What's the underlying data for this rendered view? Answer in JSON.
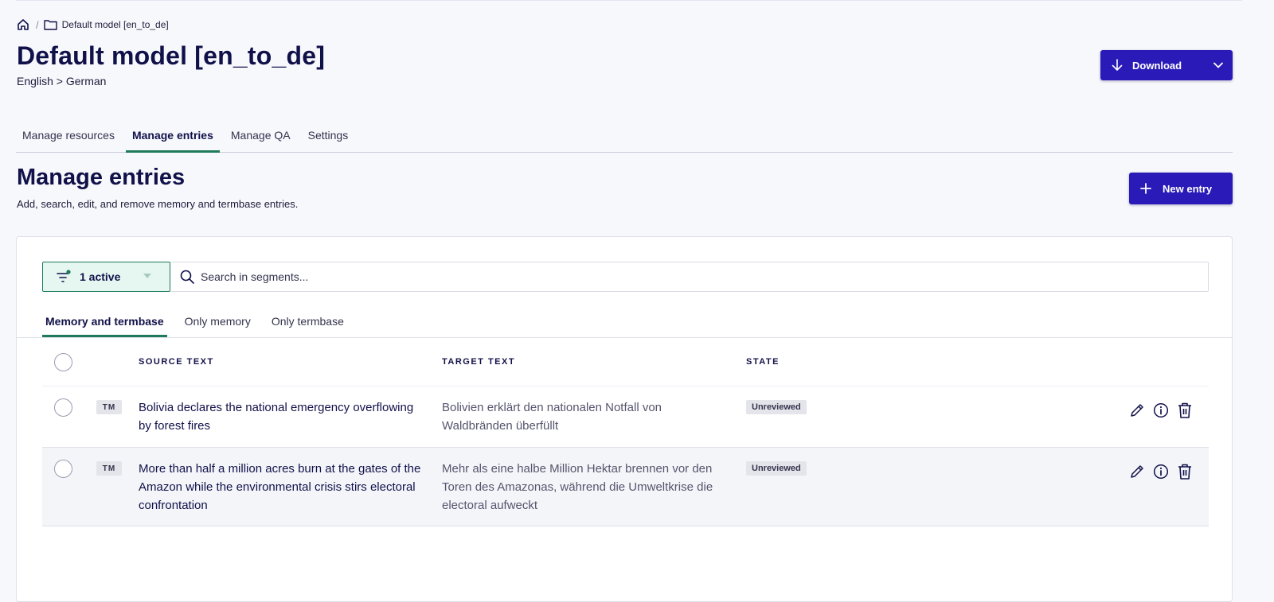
{
  "breadcrumb": {
    "current": "Default model [en_to_de]"
  },
  "header": {
    "title": "Default model [en_to_de]",
    "language_pair": "English > German",
    "download_label": "Download"
  },
  "tabs": [
    {
      "label": "Manage resources"
    },
    {
      "label": "Manage entries"
    },
    {
      "label": "Manage QA"
    },
    {
      "label": "Settings"
    }
  ],
  "section": {
    "title": "Manage entries",
    "description": "Add, search, edit, and remove memory and termbase entries.",
    "new_entry_label": "New entry"
  },
  "filter": {
    "label": "1 active"
  },
  "search": {
    "placeholder": "Search in segments..."
  },
  "subtabs": [
    {
      "label": "Memory and termbase"
    },
    {
      "label": "Only memory"
    },
    {
      "label": "Only termbase"
    }
  ],
  "table": {
    "headers": {
      "source": "SOURCE TEXT",
      "target": "TARGET TEXT",
      "state": "STATE"
    },
    "rows": [
      {
        "type": "TM",
        "source": "Bolivia declares the national emergency overflowing by forest fires",
        "target": "Bolivien erklärt den nationalen Notfall von Waldbränden überfüllt",
        "state": "Unreviewed"
      },
      {
        "type": "TM",
        "source": "More than half a million acres burn at the gates of the Amazon while the environmental crisis stirs electoral confrontation",
        "target": "Mehr als eine halbe Million Hektar brennen vor den Toren des Amazonas, während die Umweltkrise die electoral aufweckt",
        "state": "Unreviewed"
      }
    ]
  },
  "icons": {
    "home": "home-icon",
    "folder": "folder-icon",
    "download": "arrow-down-icon",
    "caret": "chevron-down-icon",
    "plus": "plus-icon",
    "filter": "filter-icon",
    "search": "search-icon",
    "edit": "pencil-icon",
    "info": "info-icon",
    "delete": "trash-icon"
  },
  "colors": {
    "primary": "#2a1bb8",
    "accent_green": "#1f7a5a",
    "title": "#11114a",
    "filter_bg": "#e6f7f1"
  }
}
